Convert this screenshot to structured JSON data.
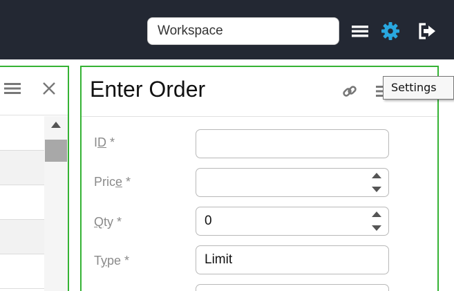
{
  "topbar": {
    "workspace_value": "Workspace",
    "icons": [
      "menu-icon",
      "gear-icon",
      "logout-icon"
    ],
    "accent": "#29a8e0"
  },
  "left_panel": {
    "icons": [
      "menu-icon",
      "close-icon"
    ],
    "border_color": "#34b233"
  },
  "order_panel": {
    "title": "Enter Order",
    "icons": [
      "link-icon",
      "menu-icon"
    ],
    "tooltip": "Settings",
    "border_color": "#34b233",
    "fields": [
      {
        "label": "ID *",
        "access_key": "D",
        "value": ""
      },
      {
        "label": "Price *",
        "access_key": "e",
        "value": ""
      },
      {
        "label": "Qty *",
        "access_key": "Q",
        "value": "0"
      },
      {
        "label": "Type *",
        "access_key": "y",
        "value": "Limit"
      }
    ]
  }
}
